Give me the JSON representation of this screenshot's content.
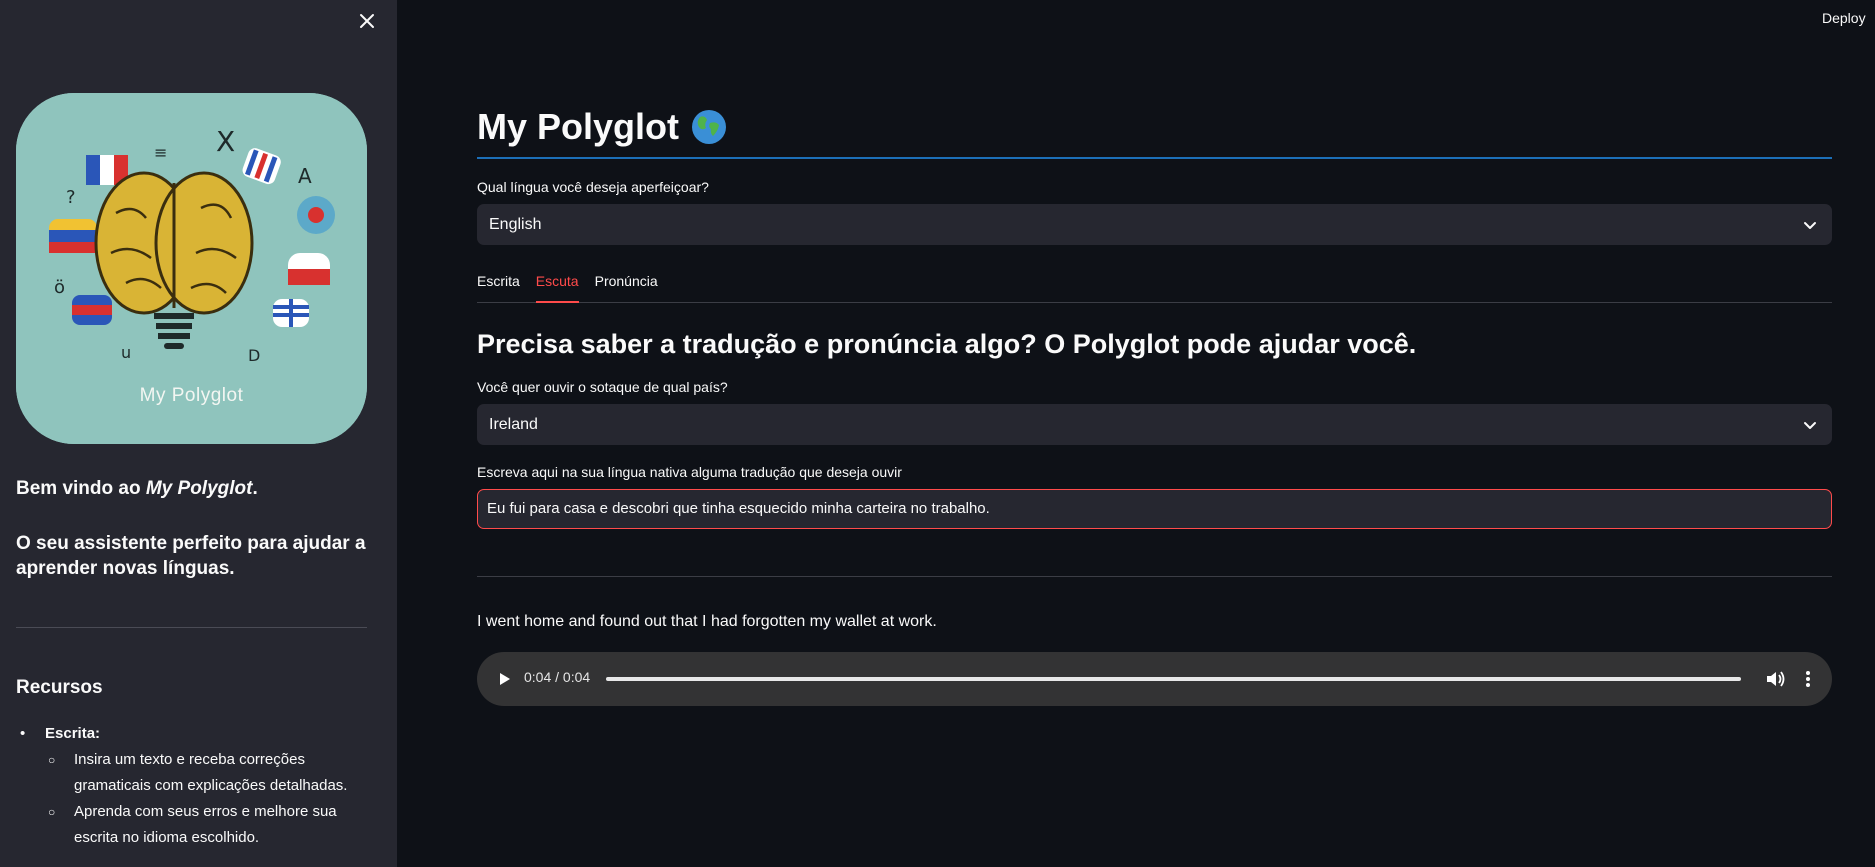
{
  "header": {
    "deploy_label": "Deploy"
  },
  "sidebar": {
    "logo_text": "My Polyglot",
    "welcome_prefix": "Bem vindo ao ",
    "welcome_app": "My Polyglot",
    "welcome_suffix": ".",
    "tagline": "O seu assistente perfeito para ajudar a aprender novas línguas.",
    "resources_title": "Recursos",
    "resources": [
      {
        "title": "Escrita:",
        "items": [
          "Insira um texto e receba correções gramaticais com explicações detalhadas.",
          "Aprenda com seus erros e melhore sua escrita no idioma escolhido."
        ]
      }
    ]
  },
  "main": {
    "title": "My Polyglot",
    "language_label": "Qual língua você deseja aperfeiçoar?",
    "language_value": "English",
    "tabs": [
      {
        "label": "Escrita",
        "active": false
      },
      {
        "label": "Escuta",
        "active": true
      },
      {
        "label": "Pronúncia",
        "active": false
      }
    ],
    "heading": "Precisa saber a tradução e pronúncia algo? O Polyglot pode ajudar você.",
    "accent_label": "Você quer ouvir o sotaque de qual país?",
    "accent_value": "Ireland",
    "input_label": "Escreva aqui na sua língua nativa alguma tradução que deseja ouvir",
    "input_value": "Eu fui para casa e descobri que tinha esquecido minha carteira no trabalho.",
    "translation": "I went home and found out that I had forgotten my wallet at work.",
    "audio": {
      "time": "0:04 / 0:04",
      "progress": 1.0
    }
  },
  "colors": {
    "background": "#0e1117",
    "sidebar": "#262730",
    "accent": "#ff4b4b",
    "title_underline": "#1c6fb8"
  }
}
